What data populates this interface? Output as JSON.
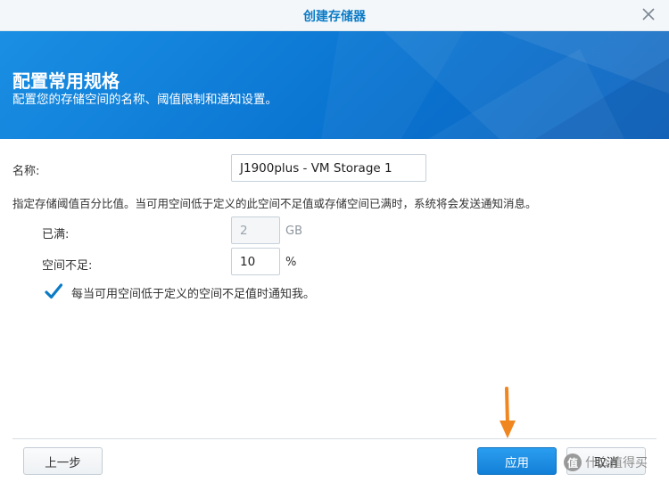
{
  "window": {
    "title": "创建存储器"
  },
  "banner": {
    "heading": "配置常用规格",
    "subheading": "配置您的存储空间的名称、阈值限制和通知设置。"
  },
  "form": {
    "name_label": "名称:",
    "name_value": "J1900plus - VM Storage 1",
    "threshold_description": "指定存储阈值百分比值。当可用空间低于定义的此空间不足值或存储空间已满时，系统将会发送通知消息。",
    "full_label": "已满:",
    "full_value": "2",
    "full_unit": "GB",
    "low_label": "空间不足:",
    "low_value": "10",
    "low_unit": "%",
    "notify_checked": true,
    "notify_label": "每当可用空间低于定义的空间不足值时通知我。"
  },
  "footer": {
    "back_label": "上一步",
    "apply_label": "应用",
    "cancel_label": "取消"
  },
  "watermark": {
    "badge": "值",
    "text": "什么值得买"
  },
  "colors": {
    "accent": "#0b7bc6",
    "banner": "#0a74d1",
    "arrow": "#f0861f"
  }
}
